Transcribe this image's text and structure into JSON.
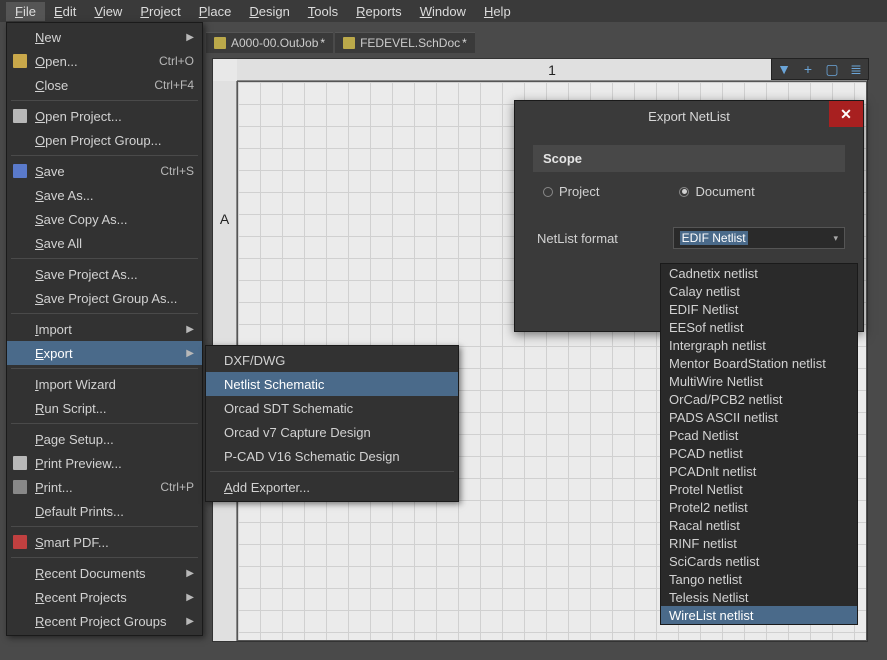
{
  "menubar": {
    "items": [
      {
        "label": "File",
        "active": true
      },
      {
        "label": "Edit"
      },
      {
        "label": "View"
      },
      {
        "label": "Project"
      },
      {
        "label": "Place"
      },
      {
        "label": "Design"
      },
      {
        "label": "Tools"
      },
      {
        "label": "Reports"
      },
      {
        "label": "Window"
      },
      {
        "label": "Help"
      }
    ]
  },
  "tabs": [
    {
      "label": "A000-00.OutJob",
      "dirty": true
    },
    {
      "label": "FEDEVEL.SchDoc",
      "dirty": true
    }
  ],
  "ruler": {
    "top": "1",
    "left": "A"
  },
  "file_menu": {
    "new": {
      "label": "New",
      "arrow": true
    },
    "open": {
      "label": "Open...",
      "shortcut": "Ctrl+O",
      "icon": "folder"
    },
    "close": {
      "label": "Close",
      "shortcut": "Ctrl+F4"
    },
    "open_project": {
      "label": "Open Project...",
      "icon": "doc"
    },
    "open_group": {
      "label": "Open Project Group..."
    },
    "save": {
      "label": "Save",
      "shortcut": "Ctrl+S",
      "icon": "save"
    },
    "save_as": {
      "label": "Save As..."
    },
    "save_copy": {
      "label": "Save Copy As..."
    },
    "save_all": {
      "label": "Save All"
    },
    "save_proj": {
      "label": "Save Project As..."
    },
    "save_group": {
      "label": "Save Project Group As..."
    },
    "import": {
      "label": "Import",
      "arrow": true
    },
    "export": {
      "label": "Export",
      "arrow": true,
      "selected": true
    },
    "import_wiz": {
      "label": "Import Wizard"
    },
    "run_script": {
      "label": "Run Script..."
    },
    "page_setup": {
      "label": "Page Setup..."
    },
    "print_preview": {
      "label": "Print Preview...",
      "icon": "doc"
    },
    "print": {
      "label": "Print...",
      "shortcut": "Ctrl+P",
      "icon": "print"
    },
    "default_prints": {
      "label": "Default Prints..."
    },
    "smart_pdf": {
      "label": "Smart PDF...",
      "icon": "pdf"
    },
    "recent_docs": {
      "label": "Recent Documents",
      "arrow": true
    },
    "recent_projs": {
      "label": "Recent Projects",
      "arrow": true
    },
    "recent_groups": {
      "label": "Recent Project Groups",
      "arrow": true
    }
  },
  "export_submenu": {
    "items": [
      {
        "label": "DXF/DWG"
      },
      {
        "label": "Netlist Schematic",
        "selected": true
      },
      {
        "label": "Orcad SDT Schematic"
      },
      {
        "label": "Orcad v7 Capture Design"
      },
      {
        "label": "P-CAD V16 Schematic Design"
      }
    ],
    "add_exporter": "Add Exporter..."
  },
  "dialog": {
    "title": "Export NetList",
    "scope_label": "Scope",
    "radio_project": "Project",
    "radio_document": "Document",
    "format_label": "NetList format",
    "selected_value": "EDIF Netlist"
  },
  "netlist_options": [
    "Cadnetix netlist",
    "Calay netlist",
    "EDIF Netlist",
    "EESof netlist",
    "Intergraph netlist",
    "Mentor BoardStation netlist",
    "MultiWire Netlist",
    "OrCad/PCB2 netlist",
    "PADS ASCII netlist",
    "Pcad Netlist",
    "PCAD netlist",
    "PCADnlt netlist",
    "Protel Netlist",
    "Protel2 netlist",
    "Racal netlist",
    "RINF netlist",
    "SciCards netlist",
    "Tango netlist",
    "Telesis Netlist",
    "WireList netlist"
  ],
  "netlist_selected": "WireList netlist"
}
